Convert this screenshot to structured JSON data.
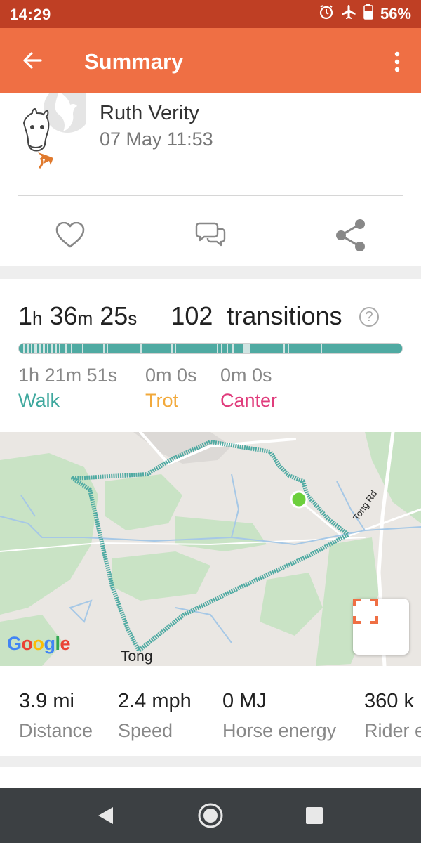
{
  "status_bar": {
    "time": "14:29",
    "battery": "56%",
    "icons": [
      "alarm-icon",
      "airplane-icon",
      "battery-icon"
    ]
  },
  "app_bar": {
    "title": "Summary",
    "back_icon": "arrow-left-icon",
    "menu_icon": "more-vertical-icon"
  },
  "profile": {
    "name": "Ruth Verity",
    "date": "07 May 11:53"
  },
  "actions": [
    "heart-icon",
    "comment-icon",
    "share-icon"
  ],
  "summary": {
    "hours": "1",
    "hours_unit": "h",
    "minutes": "36",
    "minutes_unit": "m",
    "seconds": "25",
    "seconds_unit": "s",
    "transitions_count": "102",
    "transitions_label": "transitions",
    "help": "?"
  },
  "gaits": [
    {
      "value": "1h 21m 51s",
      "label": "Walk",
      "color": "#3fa89e"
    },
    {
      "value": "0m 0s",
      "label": "Trot",
      "color": "#f2a93b"
    },
    {
      "value": "0m 0s",
      "label": "Canter",
      "color": "#e03c7c"
    }
  ],
  "map": {
    "place_label": "Tong",
    "road_label": "Tong Rd",
    "logo": "Google",
    "route_color": "#4faaa2",
    "marker_color": "#6ccf3c",
    "fullscreen_icon": "fullscreen-icon"
  },
  "stats": [
    {
      "value": "3.9 mi",
      "label": "Distance"
    },
    {
      "value": "2.4 mph",
      "label": "Speed"
    },
    {
      "value": "0 MJ",
      "label": "Horse energy"
    },
    {
      "value": "360 k",
      "label": "Rider e"
    }
  ],
  "colors": {
    "accent": "#ef6f44",
    "status_bar": "#bf3f24",
    "walk": "#3fa89e",
    "trot": "#f2a93b",
    "canter": "#e03c7c"
  }
}
